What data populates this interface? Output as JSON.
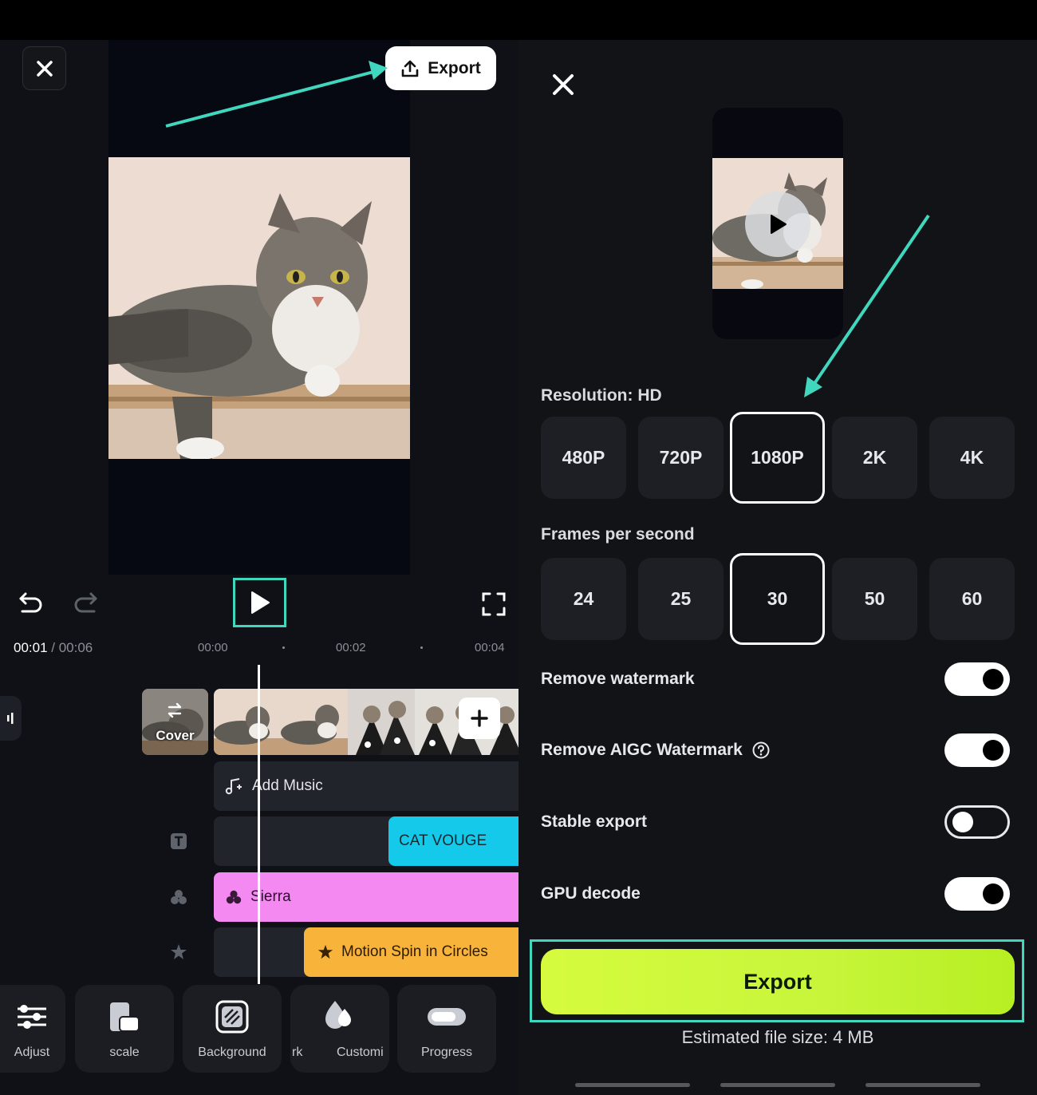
{
  "left": {
    "export_button_label": "Export",
    "time": {
      "current": "00:01",
      "separator": " / ",
      "total": "00:06"
    },
    "ruler": [
      "00:00",
      "00:02",
      "00:04"
    ],
    "cover_label": "Cover",
    "music_label": "Add Music",
    "text_clip_label": "CAT VOUGE",
    "filter_label": "Sierra",
    "effect_label": "Motion Spin in Circles",
    "tools": [
      {
        "label": "Adjust",
        "icon": "sliders-icon"
      },
      {
        "label": "scale",
        "icon": "scale-icon"
      },
      {
        "label": "Background",
        "icon": "background-icon"
      },
      {
        "label": "rk",
        "icon": "watermark-icon"
      },
      {
        "label": "Customi",
        "icon": "drops-icon"
      },
      {
        "label": "Progress",
        "icon": "progress-icon"
      }
    ]
  },
  "right": {
    "resolution_label": "Resolution: HD",
    "resolutions": [
      "480P",
      "720P",
      "1080P",
      "2K",
      "4K"
    ],
    "selected_resolution": "1080P",
    "fps_label": "Frames per second",
    "fps_options": [
      "24",
      "25",
      "30",
      "50",
      "60"
    ],
    "selected_fps": "30",
    "toggles": [
      {
        "label": "Remove watermark",
        "on": true
      },
      {
        "label": "Remove AIGC Watermark",
        "on": true,
        "help": true
      },
      {
        "label": "Stable export",
        "on": false
      },
      {
        "label": "GPU decode",
        "on": true
      }
    ],
    "export_label": "Export",
    "estimated_size": "Estimated file size: 4 MB"
  },
  "colors": {
    "highlight": "#41d6be",
    "export_green": "#c7f53a",
    "text_clip": "#14c9ea",
    "filter_clip": "#f489f2",
    "effect_clip": "#f8b43a"
  }
}
